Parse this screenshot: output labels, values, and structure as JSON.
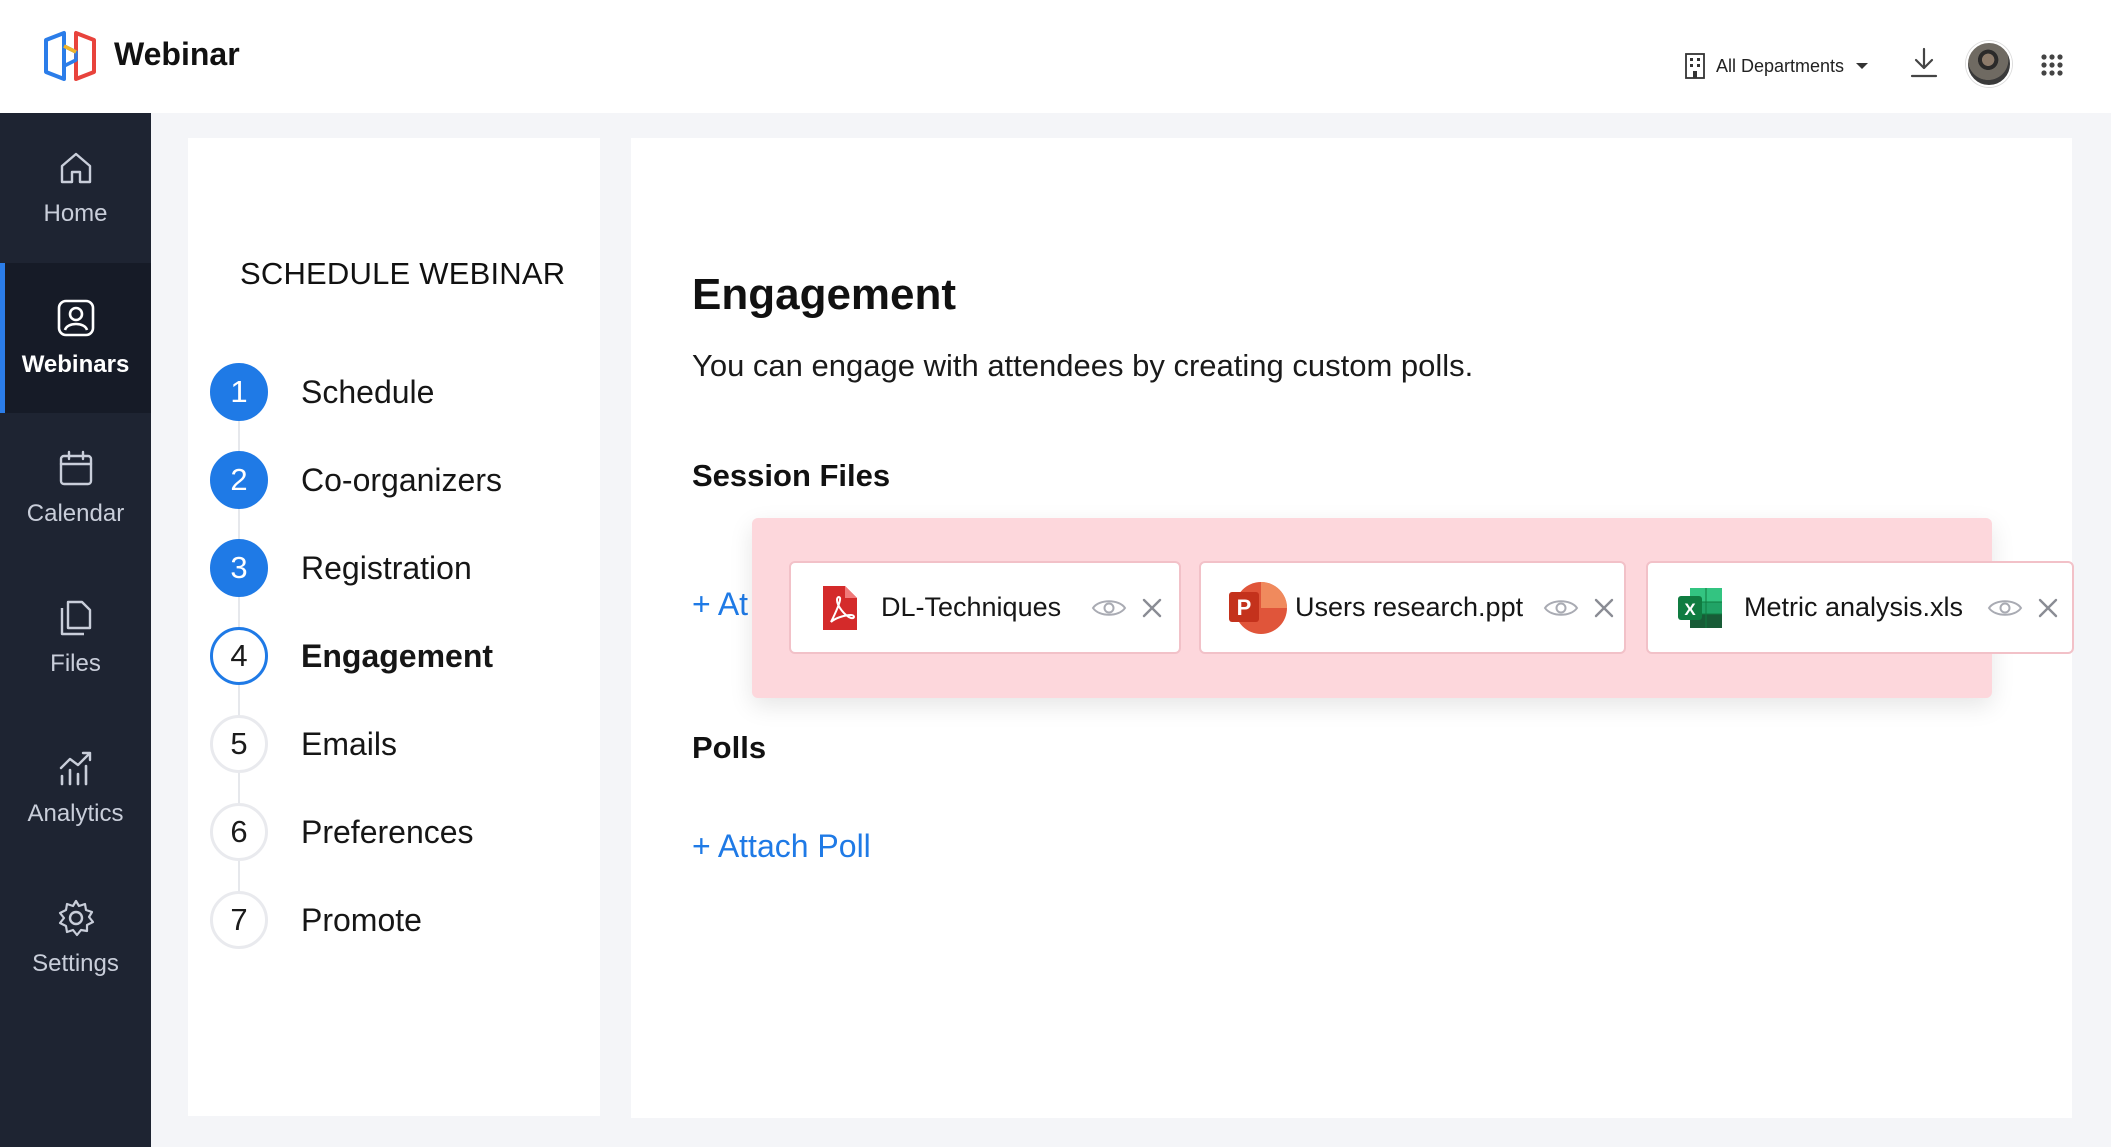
{
  "header": {
    "app_title": "Webinar",
    "department_selector": "All Departments",
    "icons": [
      "building-icon",
      "caret-down-icon",
      "download-icon",
      "avatar",
      "apps-grid-icon"
    ]
  },
  "sidebar": {
    "items": [
      {
        "label": "Home",
        "icon": "home-icon",
        "active": false
      },
      {
        "label": "Webinars",
        "icon": "webinar-icon",
        "active": true
      },
      {
        "label": "Calendar",
        "icon": "calendar-icon",
        "active": false
      },
      {
        "label": "Files",
        "icon": "files-icon",
        "active": false
      },
      {
        "label": "Analytics",
        "icon": "analytics-icon",
        "active": false
      },
      {
        "label": "Settings",
        "icon": "settings-icon",
        "active": false
      }
    ]
  },
  "steps_panel": {
    "title": "SCHEDULE WEBINAR",
    "steps": [
      {
        "number": "1",
        "label": "Schedule",
        "state": "done"
      },
      {
        "number": "2",
        "label": "Co-organizers",
        "state": "done"
      },
      {
        "number": "3",
        "label": "Registration",
        "state": "done"
      },
      {
        "number": "4",
        "label": "Engagement",
        "state": "current"
      },
      {
        "number": "5",
        "label": "Emails",
        "state": "todo"
      },
      {
        "number": "6",
        "label": "Preferences",
        "state": "todo"
      },
      {
        "number": "7",
        "label": "Promote",
        "state": "todo"
      }
    ]
  },
  "main": {
    "title": "Engagement",
    "description": "You can engage with attendees by creating custom polls.",
    "session_files_title": "Session Files",
    "attach_file_partial": "+ At",
    "polls_title": "Polls",
    "attach_poll": "+ Attach Poll",
    "files": [
      {
        "name": "DL-Techniques",
        "type": "pdf-icon"
      },
      {
        "name": "Users research.ppt",
        "type": "powerpoint-icon"
      },
      {
        "name": "Metric analysis.xls",
        "type": "excel-icon"
      }
    ]
  },
  "colors": {
    "accent": "#1f7ae6",
    "sidebar_bg": "#1e2432",
    "highlight_bg": "#fdd7dc",
    "pdf_red": "#d42a2a",
    "ppt_orange": "#e0553a",
    "xls_green": "#1f8a4c"
  }
}
